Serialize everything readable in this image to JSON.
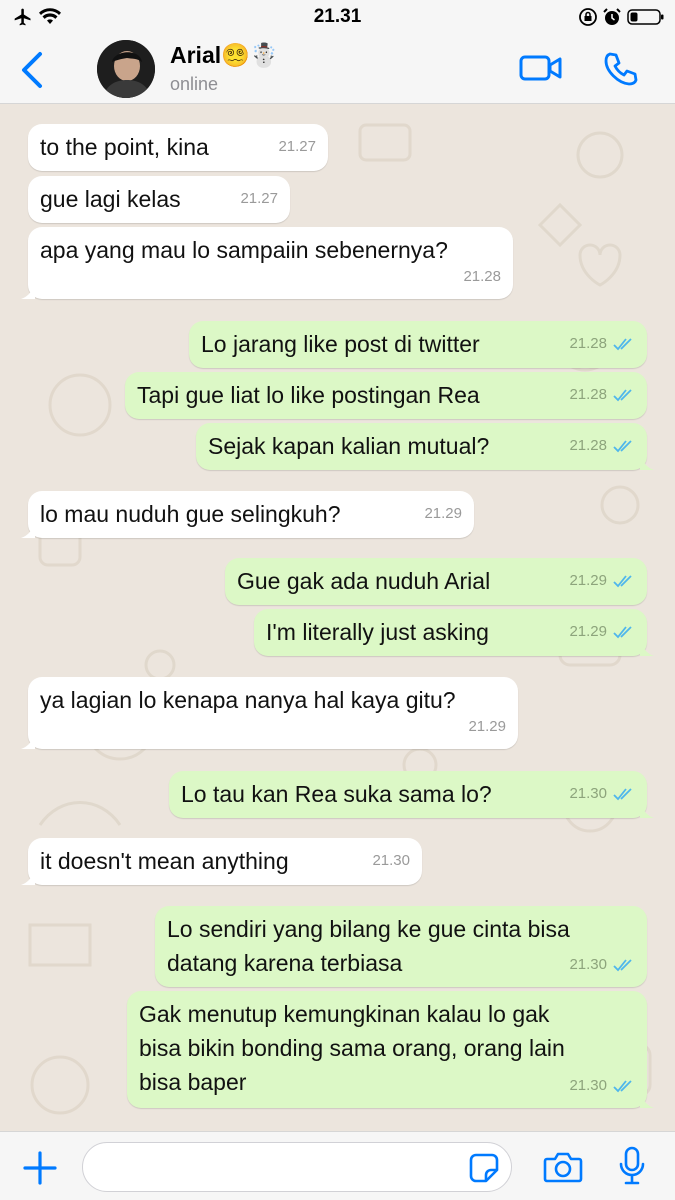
{
  "status_bar": {
    "time": "21.31"
  },
  "header": {
    "contact_name": "Arial😵‍💫☃️",
    "contact_status": "online"
  },
  "messages": [
    {
      "dir": "in",
      "text": "to the point, kina",
      "time": "21.27"
    },
    {
      "dir": "in",
      "text": "gue lagi kelas",
      "time": "21.27"
    },
    {
      "dir": "in",
      "text": "apa yang mau lo sampaiin sebenernya?",
      "time": "21.28"
    },
    {
      "dir": "out",
      "text": "Lo jarang like post di twitter",
      "time": "21.28",
      "status": "read"
    },
    {
      "dir": "out",
      "text": "Tapi gue liat lo like postingan Rea",
      "time": "21.28",
      "status": "read"
    },
    {
      "dir": "out",
      "text": "Sejak kapan kalian mutual?",
      "time": "21.28",
      "status": "read"
    },
    {
      "dir": "in",
      "text": "lo mau nuduh gue selingkuh?",
      "time": "21.29"
    },
    {
      "dir": "out",
      "text": "Gue gak ada nuduh Arial",
      "time": "21.29",
      "status": "read"
    },
    {
      "dir": "out",
      "text": "I'm literally just asking",
      "time": "21.29",
      "status": "read"
    },
    {
      "dir": "in",
      "text": "ya lagian lo kenapa nanya hal kaya gitu?",
      "time": "21.29"
    },
    {
      "dir": "out",
      "text": "Lo tau kan Rea suka sama lo?",
      "time": "21.30",
      "status": "read"
    },
    {
      "dir": "in",
      "text": "it doesn't mean anything",
      "time": "21.30"
    },
    {
      "dir": "out",
      "text": "Lo sendiri yang bilang ke gue cinta bisa\ndatang karena terbiasa",
      "time": "21.30",
      "status": "read"
    },
    {
      "dir": "out",
      "text": "Gak menutup kemungkinan kalau lo gak\nbisa bikin bonding sama orang, orang lain\nbisa baper",
      "time": "21.30",
      "status": "read"
    }
  ],
  "input": {
    "placeholder": "",
    "value": ""
  },
  "icons": {
    "back": "chevron-left-icon",
    "video": "video-camera-icon",
    "call": "phone-icon",
    "plus": "plus-icon",
    "sticker": "sticker-icon",
    "camera": "camera-icon",
    "mic": "microphone-icon"
  },
  "colors": {
    "accent": "#007AFF",
    "outgoing_bubble": "#DCF8C6",
    "incoming_bubble": "#FFFFFF",
    "read_ticks": "#4FB6EC",
    "background": "#ECE5DD"
  }
}
